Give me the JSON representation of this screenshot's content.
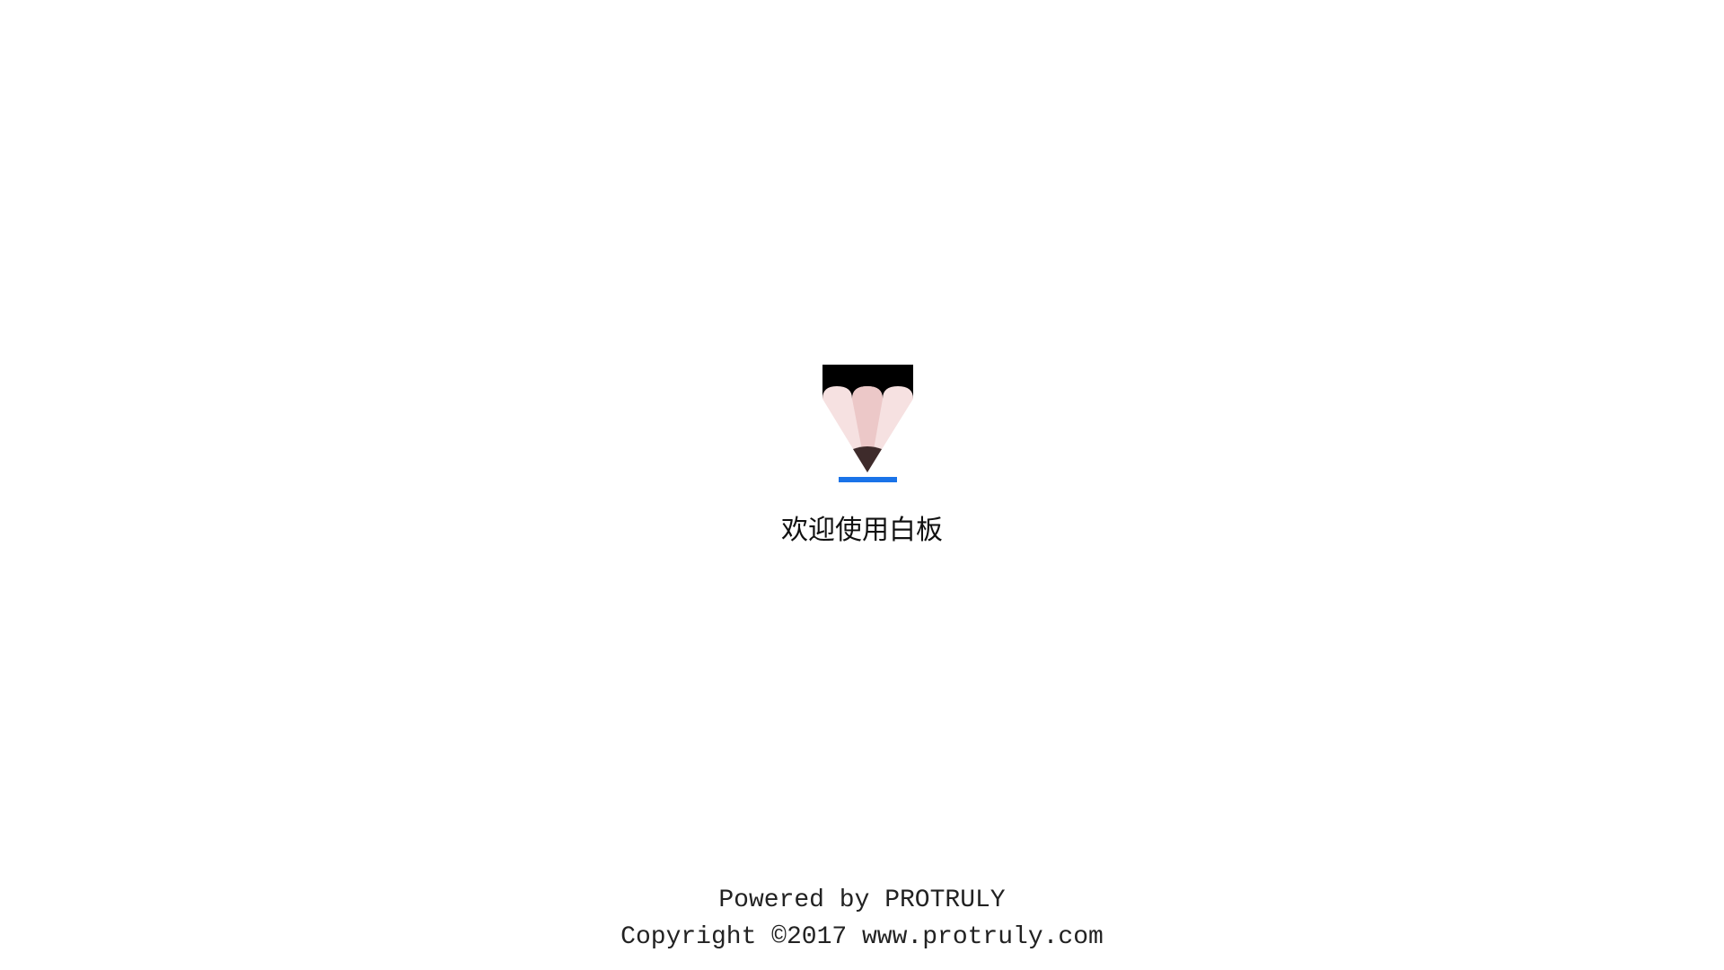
{
  "splash": {
    "logo_icon": "pencil-icon",
    "welcome_text": "欢迎使用白板",
    "powered_by": "Powered by PROTRULY",
    "copyright": "Copyright ©2017 www.protruly.com"
  },
  "colors": {
    "background": "#ffffff",
    "pencil_body": "#000000",
    "pencil_wood_light": "#f6e1e1",
    "pencil_wood_mid": "#ecc8c8",
    "pencil_tip": "#3e2b2b",
    "underline_accent": "#1a73e8"
  }
}
